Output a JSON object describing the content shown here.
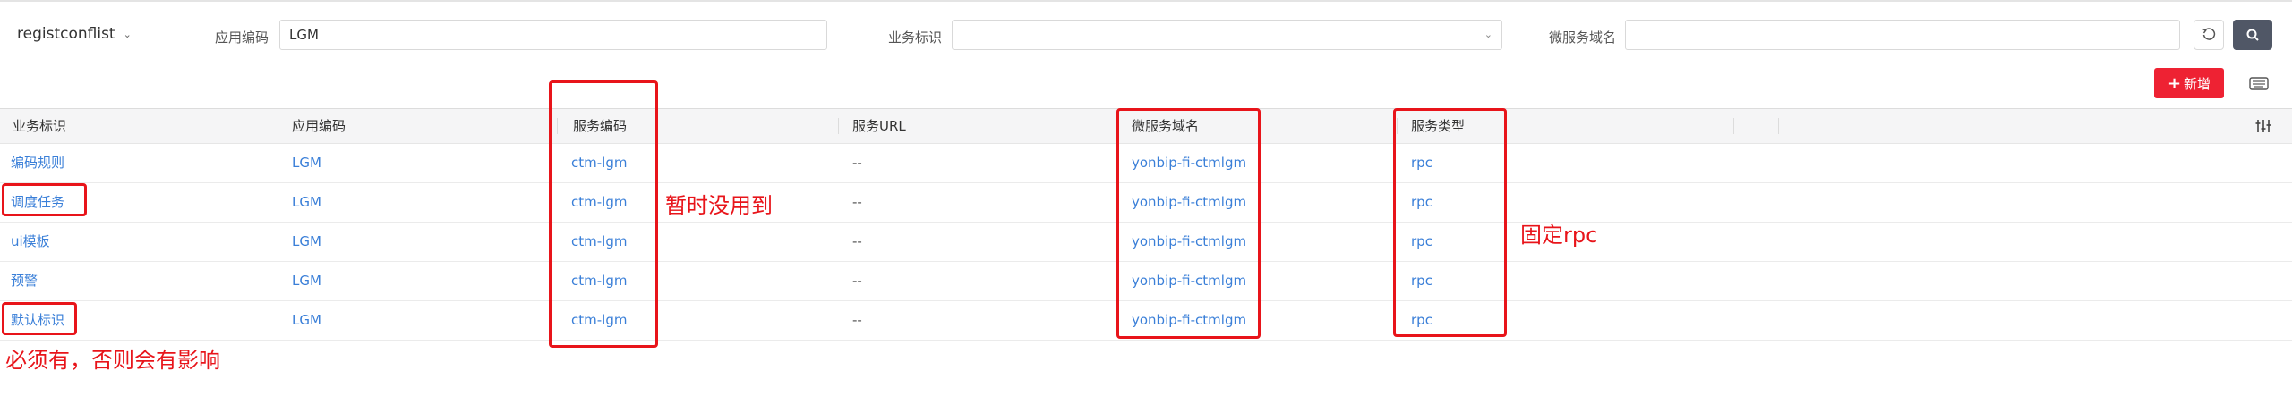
{
  "filter": {
    "app_selector": "registconflist",
    "app_code_label": "应用编码",
    "app_code_value": "LGM",
    "biz_id_label": "业务标识",
    "biz_id_value": "",
    "micro_service_label": "微服务域名",
    "micro_service_value": ""
  },
  "toolbar": {
    "add_label": "新增"
  },
  "table": {
    "headers": [
      "业务标识",
      "应用编码",
      "服务编码",
      "服务URL",
      "微服务域名",
      "服务类型"
    ],
    "rows": [
      [
        "编码规则",
        "LGM",
        "ctm-lgm",
        "--",
        "yonbip-fi-ctmlgm",
        "rpc"
      ],
      [
        "调度任务",
        "LGM",
        "ctm-lgm",
        "--",
        "yonbip-fi-ctmlgm",
        "rpc"
      ],
      [
        "ui模板",
        "LGM",
        "ctm-lgm",
        "--",
        "yonbip-fi-ctmlgm",
        "rpc"
      ],
      [
        "预警",
        "LGM",
        "ctm-lgm",
        "--",
        "yonbip-fi-ctmlgm",
        "rpc"
      ],
      [
        "默认标识",
        "LGM",
        "ctm-lgm",
        "--",
        "yonbip-fi-ctmlgm",
        "rpc"
      ]
    ]
  },
  "annotations": {
    "service_code_note": "暂时没用到",
    "service_type_note": "固定rpc",
    "biz_id_note": "必须有，否则会有影响"
  },
  "colors": {
    "accent_red": "#ee2233",
    "annotation_red": "#e8141a",
    "link_blue": "#3a7fd8",
    "search_button": "#505766"
  }
}
